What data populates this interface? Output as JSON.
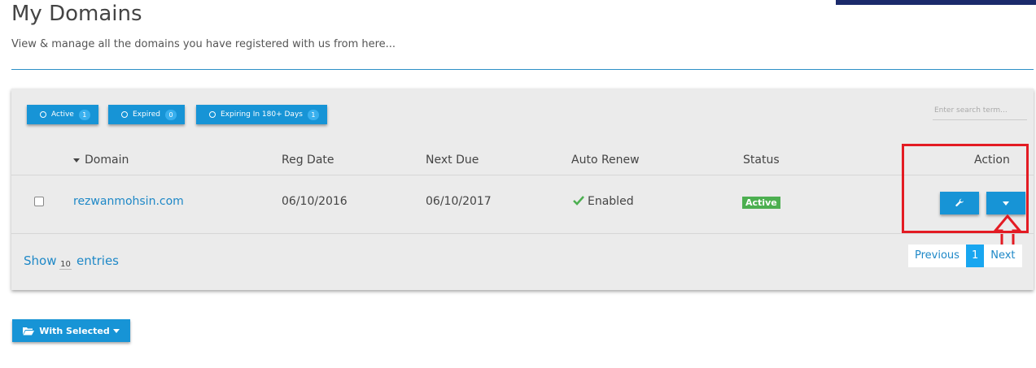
{
  "page": {
    "title": "My Domains",
    "subtitle": "View & manage all the domains you have registered with us from here..."
  },
  "filters": [
    {
      "label": "Active",
      "count": "1"
    },
    {
      "label": "Expired",
      "count": "0"
    },
    {
      "label": "Expiring In 180+ Days",
      "count": "1"
    }
  ],
  "search": {
    "placeholder": "Enter search term..."
  },
  "table": {
    "columns": {
      "domain": "Domain",
      "reg_date": "Reg Date",
      "next_due": "Next Due",
      "auto_renew": "Auto Renew",
      "status": "Status",
      "action": "Action"
    },
    "rows": [
      {
        "domain": "rezwanmohsin.com",
        "reg_date": "06/10/2016",
        "next_due": "06/10/2017",
        "auto_renew": "Enabled",
        "status": "Active"
      }
    ]
  },
  "entries": {
    "show": "Show",
    "count": "10",
    "label": "entries"
  },
  "pagination": {
    "previous": "Previous",
    "current": "1",
    "next": "Next"
  },
  "bulk": {
    "with_selected": "With Selected"
  },
  "colors": {
    "primary": "#1794d6",
    "status_active": "#4caf50",
    "highlight": "#e31b23",
    "link": "#1e88c7"
  },
  "icons": [
    "check-icon",
    "wrench-icon",
    "caret-down-icon",
    "folder-open-icon",
    "arrow-up-icon"
  ]
}
